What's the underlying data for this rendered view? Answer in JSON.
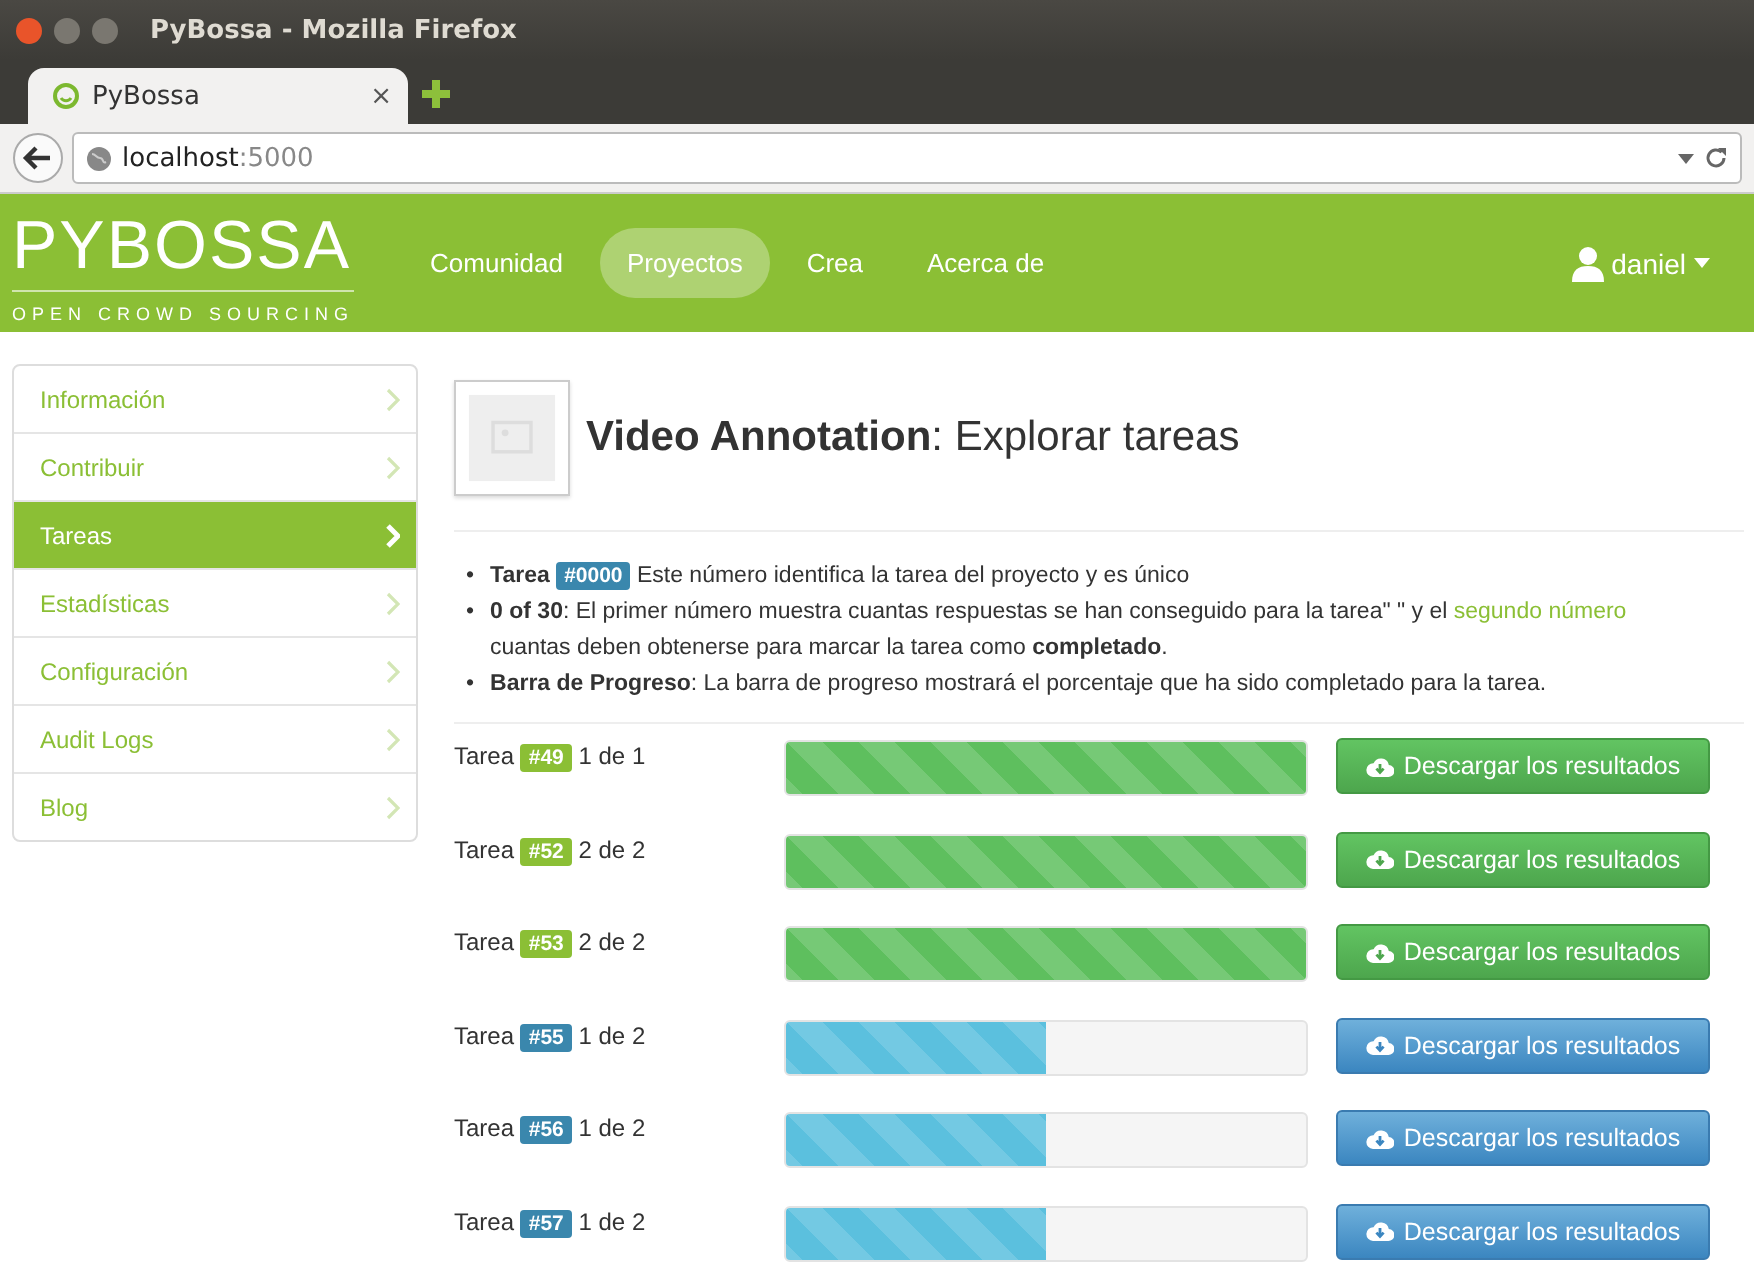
{
  "window": {
    "title": "PyBossa - Mozilla Firefox"
  },
  "tab": {
    "label": "PyBossa",
    "close": "×"
  },
  "address": {
    "host": "localhost",
    "port": ":5000"
  },
  "navbar": {
    "logo": "PYBOSSA",
    "tagline": "OPEN CROWD SOURCING",
    "items": [
      {
        "label": "Comunidad",
        "selected": false
      },
      {
        "label": "Proyectos",
        "selected": true
      },
      {
        "label": "Crea",
        "selected": false
      },
      {
        "label": "Acerca de",
        "selected": false
      }
    ],
    "user": "daniel"
  },
  "sidebar": {
    "items": [
      {
        "label": "Información",
        "selected": false
      },
      {
        "label": "Contribuir",
        "selected": false
      },
      {
        "label": "Tareas",
        "selected": true
      },
      {
        "label": "Estadísticas",
        "selected": false
      },
      {
        "label": "Configuración",
        "selected": false
      },
      {
        "label": "Audit Logs",
        "selected": false
      },
      {
        "label": "Blog",
        "selected": false
      }
    ]
  },
  "header": {
    "title_bold": "Video Annotation",
    "title_rest": ": Explorar tareas"
  },
  "legend": [
    {
      "marker": "•",
      "text": "**Tarea**",
      "badge": "#0000",
      "after": " Este número identifica la tarea del proyecto y es único"
    },
    {
      "marker": "•",
      "text": "**0 of 30**: El primer número muestra cuantas respuestas se han conseguido para la tarea\" \" y el",
      "link": "segundo número",
      "after": " cuantas deben obtenerse para marcar la tarea como **completado**."
    },
    {
      "marker": "•",
      "text": "**Barra de Progreso**: La barra de progreso mostrará el porcentaje que ha sido completado para la tarea."
    }
  ],
  "tasks": [
    {
      "label": "Tarea",
      "id": "#49",
      "count": "1 de 1",
      "kind": "completed",
      "level": 1,
      "button": "Descargar los resultados"
    },
    {
      "label": "Tarea",
      "id": "#52",
      "count": "2 de 2",
      "kind": "completed",
      "level": 1,
      "button": "Descargar los resultados"
    },
    {
      "label": "Tarea",
      "id": "#53",
      "count": "2 de 2",
      "kind": "completed",
      "level": 1,
      "button": "Descargar los resultados"
    },
    {
      "label": "Tarea",
      "id": "#55",
      "count": "1 de 2",
      "kind": "pending",
      "level": 0.5,
      "button": "Descargar los resultados"
    },
    {
      "label": "Tarea",
      "id": "#56",
      "count": "1 de 2",
      "kind": "pending",
      "level": 0.5,
      "button": "Descargar los resultados"
    },
    {
      "label": "Tarea",
      "id": "#57",
      "count": "1 de 2",
      "kind": "pending",
      "level": 0.5,
      "button": "Descargar los resultados"
    }
  ]
}
